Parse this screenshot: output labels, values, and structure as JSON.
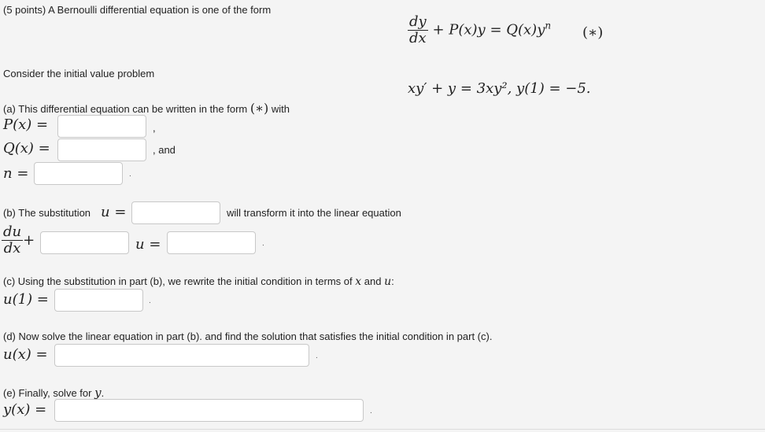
{
  "intro": {
    "points": "(5 points)",
    "text": "A Bernoulli differential equation is one of the form",
    "form_equation": {
      "lhs_frac_num": "dy",
      "lhs_frac_den": "dx",
      "rest": "+ P(x)y = Q(x)y",
      "exponent": "n",
      "tag": "(∗)"
    }
  },
  "ivp": {
    "text": "Consider the initial value problem",
    "equation": "xy′ + y = 3xy², y(1) = −5."
  },
  "part_a": {
    "text": "(a) This differential equation can be written in the form",
    "form_ref": "(∗)",
    "with": "with",
    "p_label": "P(x) =",
    "q_label": "Q(x) =",
    "n_label": "n =",
    "p_value": "",
    "q_value": "",
    "n_value": "",
    "comma": ",",
    "and": ", and",
    "period": "."
  },
  "part_b": {
    "text": "(b) The substitution",
    "u_label": "u =",
    "u_value": "",
    "after": "will transform it into the linear equation",
    "frac_num": "du",
    "frac_den": "dx",
    "plus": "+",
    "coef_value": "",
    "u_eq": "u =",
    "rhs_value": "",
    "period": "."
  },
  "part_c": {
    "text": "(c) Using the substitution in part (b), we rewrite the initial condition in terms of",
    "x_var": "x",
    "and": "and",
    "u_var": "u",
    "colon": ":",
    "label": "u(1) =",
    "value": "",
    "period": "."
  },
  "part_d": {
    "text": "(d) Now solve the linear equation in part (b). and find the solution that satisfies the initial condition in part (c).",
    "label": "u(x) =",
    "value": "",
    "period": "."
  },
  "part_e": {
    "text": "(e) Finally, solve for",
    "var": "y",
    "end": ".",
    "label": "y(x) =",
    "value": "",
    "period": "."
  }
}
